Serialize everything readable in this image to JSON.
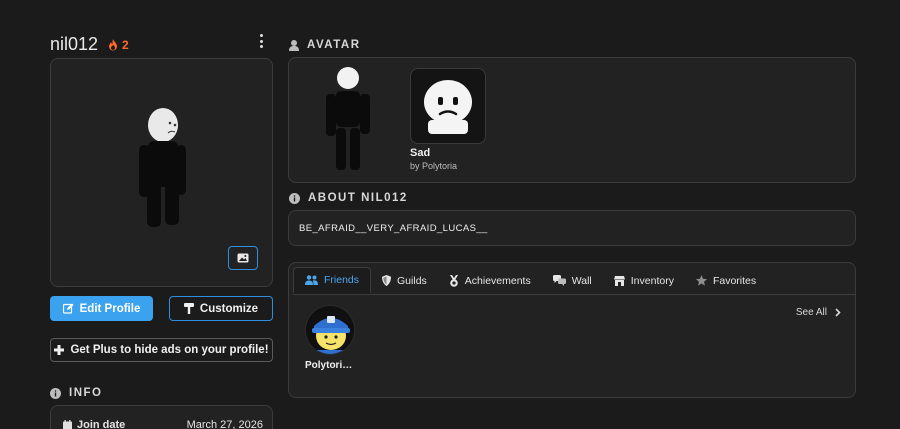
{
  "profile": {
    "username": "nil012",
    "streak_count": "2",
    "streak_color": "#ff6a2b"
  },
  "left": {
    "edit_profile_label": "Edit Profile",
    "customize_label": "Customize",
    "get_plus_label": "Get Plus to hide ads on your profile!",
    "info_title": "INFO",
    "info_rows": [
      {
        "label": "Join date",
        "value": "March 27, 2026"
      }
    ]
  },
  "avatar_section": {
    "title": "AVATAR",
    "item": {
      "name": "Sad",
      "by": "by Polytoria"
    }
  },
  "about_section": {
    "title": "ABOUT NIL012",
    "bio": "BE_AFRAID__VERY_AFRAID_LUCAS__"
  },
  "tabs": [
    {
      "label": "Friends",
      "icon": "users-icon",
      "active": true
    },
    {
      "label": "Guilds",
      "icon": "shield-icon"
    },
    {
      "label": "Achievements",
      "icon": "medal-icon"
    },
    {
      "label": "Wall",
      "icon": "chat-icon"
    },
    {
      "label": "Inventory",
      "icon": "store-icon"
    },
    {
      "label": "Favorites",
      "icon": "star-icon"
    }
  ],
  "friends": {
    "see_all_label": "See All",
    "list": [
      {
        "name": "Polytori…"
      }
    ]
  },
  "colors": {
    "accent": "#3aa2ee",
    "background": "#1b1b1b",
    "panel": "#222222",
    "border": "#3c3c3c"
  }
}
